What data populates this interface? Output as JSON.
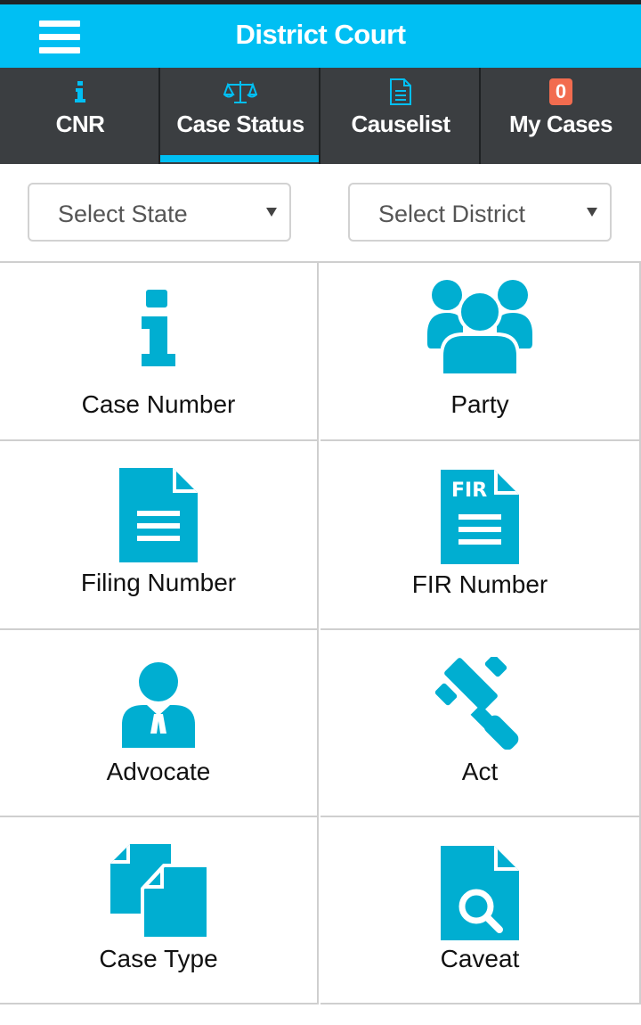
{
  "header": {
    "title": "District Court"
  },
  "tabs": [
    {
      "label": "CNR",
      "icon": "info-icon"
    },
    {
      "label": "Case Status",
      "icon": "scales-icon"
    },
    {
      "label": "Causelist",
      "icon": "document-icon"
    },
    {
      "label": "My Cases",
      "icon": "badge",
      "badge": "0"
    }
  ],
  "active_tab": "Case Status",
  "filters": {
    "state_placeholder": "Select State",
    "district_placeholder": "Select District"
  },
  "search_options": [
    {
      "label": "Case Number",
      "icon": "info-icon"
    },
    {
      "label": "Party",
      "icon": "people-group-icon"
    },
    {
      "label": "Filing Number",
      "icon": "document-icon"
    },
    {
      "label": "FIR Number",
      "icon": "fir-document-icon"
    },
    {
      "label": "Advocate",
      "icon": "advocate-icon"
    },
    {
      "label": "Act",
      "icon": "gavel-icon"
    },
    {
      "label": "Case Type",
      "icon": "documents-copy-icon"
    },
    {
      "label": "Caveat",
      "icon": "document-search-icon"
    }
  ],
  "colors": {
    "accent": "#00bff3",
    "tabbar": "#3b3e41",
    "badge": "#f26c4f",
    "icon": "#00aed1"
  }
}
